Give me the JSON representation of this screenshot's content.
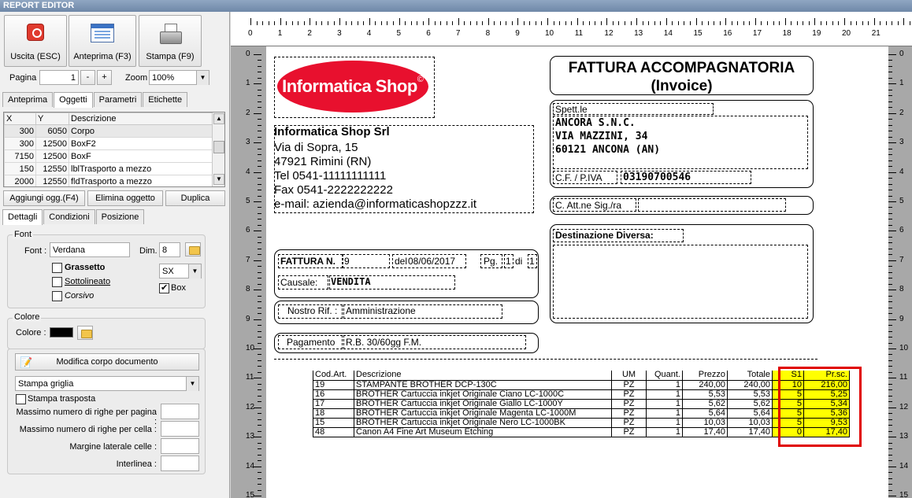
{
  "window": {
    "title": "REPORT EDITOR"
  },
  "toolbar": {
    "exit_label": "Uscita (ESC)",
    "preview_label": "Anteprima (F3)",
    "print_label": "Stampa (F9)",
    "page_label": "Pagina",
    "page_value": "1",
    "page_minus": "-",
    "page_plus": "+",
    "zoom_label": "Zoom",
    "zoom_value": "100%"
  },
  "top_tabs": [
    "Anteprima",
    "Oggetti",
    "Parametri",
    "Etichette"
  ],
  "objects": {
    "columns": [
      "X",
      "Y",
      "Descrizione"
    ],
    "rows": [
      [
        "300",
        "6050",
        "Corpo"
      ],
      [
        "300",
        "12500",
        "BoxF2"
      ],
      [
        "7150",
        "12500",
        "BoxF"
      ],
      [
        "150",
        "12550",
        "lblTrasporto a mezzo"
      ],
      [
        "2000",
        "12550",
        "fldTrasporto a mezzo"
      ]
    ]
  },
  "object_buttons": {
    "add": "Aggiungi ogg.(F4)",
    "delete": "Elimina oggetto",
    "duplicate": "Duplica"
  },
  "sub_tabs": [
    "Dettagli",
    "Condizioni",
    "Posizione"
  ],
  "font": {
    "group_label": "Font",
    "font_label": "Font :",
    "font_value": "Verdana",
    "size_label": "Dim.",
    "size_value": "8",
    "bold": "Grassetto",
    "underline": "Sottolineato",
    "italic": "Corsivo",
    "align_value": "SX",
    "box_label": "Box"
  },
  "color": {
    "group_label": "Colore",
    "color_label": "Colore :",
    "swatch": "#000000"
  },
  "body": {
    "edit_button": "Modifica corpo documento",
    "grid_select": "Stampa griglia",
    "transposed": "Stampa trasposta",
    "max_rows_page": "Massimo numero di righe per pagina :",
    "max_rows_cell": "Massimo numero di righe per cella :",
    "cell_margin": "Margine laterale celle :",
    "line_spacing": "Interlinea :"
  },
  "ruler": {
    "top": [
      "0",
      "1",
      "2",
      "3",
      "4",
      "5",
      "6",
      "7",
      "8",
      "9",
      "10",
      "11",
      "12",
      "13",
      "14",
      "15",
      "16",
      "17",
      "18",
      "19",
      "20",
      "21"
    ],
    "side": [
      "0",
      "1",
      "2",
      "3",
      "4",
      "5",
      "6",
      "7",
      "8",
      "9",
      "10",
      "11",
      "12",
      "13",
      "14",
      "15"
    ]
  },
  "invoice": {
    "logo_text": "Informatica Shop",
    "logo_mark": "©",
    "title_line1": "FATTURA ACCOMPAGNATORIA",
    "title_line2": "(Invoice)",
    "company_name": "Informatica Shop Srl",
    "company_address": "Via di Sopra, 15",
    "company_city": "47921 Rimini (RN)",
    "company_tel": "Tel 0541-11111111111",
    "company_fax": "Fax 0541-2222222222",
    "company_email": "e-mail: azienda@informaticashopzzz.it",
    "recipient_label": "Spett.le",
    "recipient_name": "ANCORA S.N.C.",
    "recipient_street": "VIA MAZZINI, 34",
    "recipient_city": "60121 ANCONA (AN)",
    "vat_label": "C.F. / P.IVA",
    "vat_value": "03190700546",
    "attn_label": "C. Att.ne Sig./ra",
    "dest_label": "Destinazione Diversa:",
    "inv_label": "FATTURA N.",
    "inv_number": "9",
    "date_label": "del",
    "date_value": "08/06/2017",
    "pg_label": "Pg.",
    "pg_num": "1",
    "pg_of": "di",
    "pg_total": "1",
    "cause_label": "Causale:",
    "cause_value": "VENDITA",
    "ref_label": "Nostro Rif. :",
    "ref_value": "Amministrazione",
    "pay_label": "Pagamento",
    "pay_value": "R.B. 30/60gg F.M."
  },
  "items": {
    "columns": [
      "Cod.Art.",
      "Descrizione",
      "UM",
      "Quant.",
      "Prezzo",
      "Totale",
      "S1",
      "Pr.sc."
    ],
    "rows": [
      [
        "19",
        "STAMPANTE BROTHER DCP-130C",
        "PZ",
        "1",
        "240,00",
        "240,00",
        "10",
        "216,00"
      ],
      [
        "16",
        "BROTHER Cartuccia inkjet Originale Ciano LC-1000C",
        "PZ",
        "1",
        "5,53",
        "5,53",
        "5",
        "5,25"
      ],
      [
        "17",
        "BROTHER Cartuccia inkjet Originale Giallo LC-1000Y",
        "PZ",
        "1",
        "5,62",
        "5,62",
        "5",
        "5,34"
      ],
      [
        "18",
        "BROTHER Cartuccia inkjet Originale Magenta LC-1000M",
        "PZ",
        "1",
        "5,64",
        "5,64",
        "5",
        "5,36"
      ],
      [
        "15",
        "BROTHER Cartuccia inkjet Originale Nero LC-1000BK",
        "PZ",
        "1",
        "10,03",
        "10,03",
        "5",
        "9,53"
      ],
      [
        "48",
        "Canon A4 Fine Art Museum Etching",
        "PZ",
        "1",
        "17,40",
        "17,40",
        "0",
        "17,40"
      ]
    ]
  },
  "colors": {
    "logo_red": "#e8102e",
    "highlight": "#ffff00",
    "frame_red": "#e00000"
  }
}
